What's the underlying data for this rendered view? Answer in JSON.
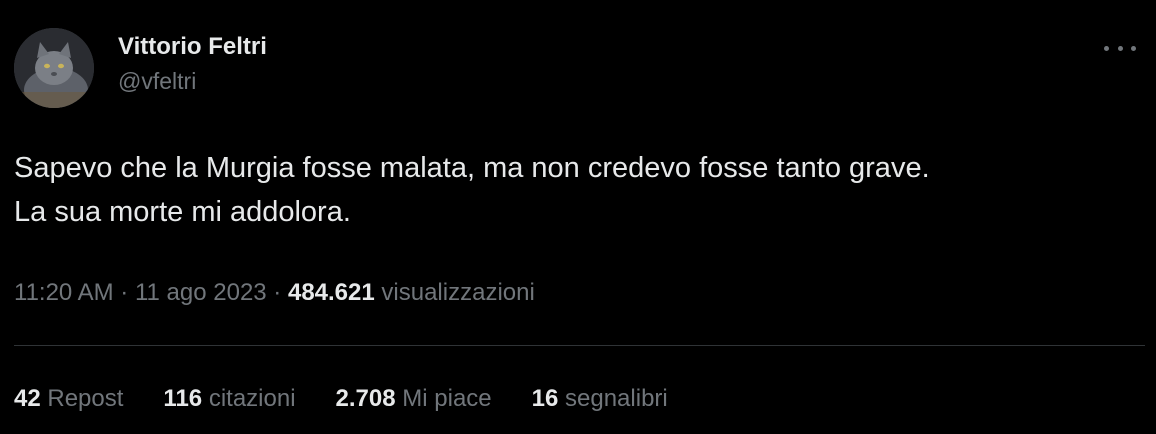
{
  "author": {
    "display_name": "Vittorio Feltri",
    "handle": "@vfeltri",
    "avatar_icon": "cat-avatar"
  },
  "tweet": {
    "lines": [
      "Sapevo che la Murgia fosse malata, ma non credevo fosse tanto grave.",
      "La sua morte mi addolora."
    ]
  },
  "meta": {
    "time": "11:20 AM",
    "separator": " · ",
    "date": "11 ago 2023",
    "views_count": "484.621",
    "views_label": "visualizzazioni"
  },
  "stats": [
    {
      "count": "42",
      "label": "Repost"
    },
    {
      "count": "116",
      "label": "citazioni"
    },
    {
      "count": "2.708",
      "label": "Mi piace"
    },
    {
      "count": "16",
      "label": "segnalibri"
    }
  ],
  "colors": {
    "background": "#000000",
    "primary_text": "#e7e9ea",
    "secondary_text": "#71767b",
    "divider": "#2f3336"
  },
  "icons": {
    "more": "more-horizontal-icon"
  }
}
